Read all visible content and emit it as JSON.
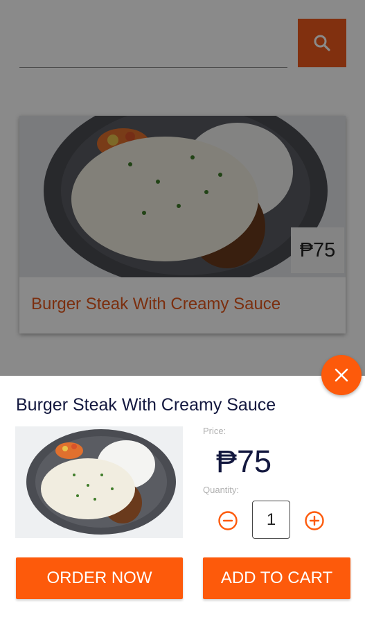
{
  "search": {
    "placeholder": "",
    "icon": "search-icon"
  },
  "card": {
    "price": "₱75",
    "title": "Burger Steak With Creamy Sauce"
  },
  "sheet": {
    "title": "Burger Steak With Creamy Sauce",
    "price_label": "Price:",
    "price_value": "₱75",
    "quantity_label": "Quantity:",
    "quantity_value": "1",
    "order_label": "ORDER NOW",
    "cart_label": "ADD TO CART"
  },
  "colors": {
    "accent": "#fd5a0b",
    "title_text": "#13183f",
    "card_title": "#e4581c"
  }
}
